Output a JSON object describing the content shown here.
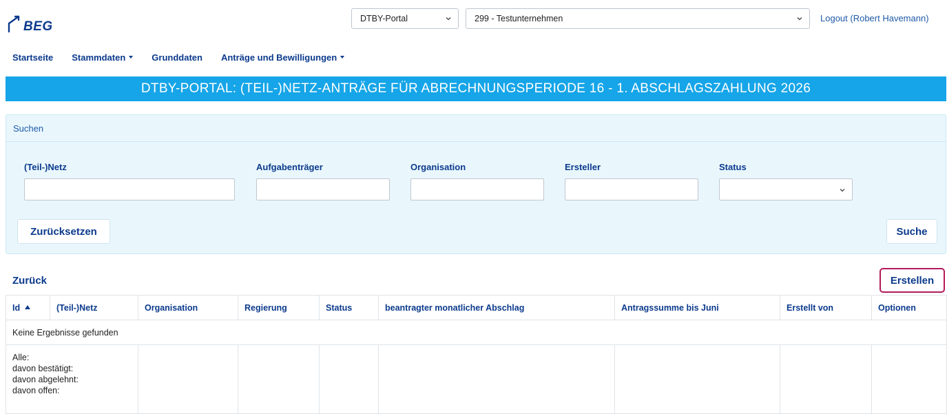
{
  "header": {
    "logo_text": "BEG",
    "portal_select": "DTBY-Portal",
    "company_select": "299 - Testunternehmen",
    "logout": "Logout (Robert Havemann)"
  },
  "nav": {
    "items": [
      {
        "label": "Startseite",
        "dropdown": false
      },
      {
        "label": "Stammdaten",
        "dropdown": true
      },
      {
        "label": "Grunddaten",
        "dropdown": false
      },
      {
        "label": "Anträge und Bewilligungen",
        "dropdown": true
      }
    ]
  },
  "banner": {
    "title": "DTBY-PORTAL: (TEIL-)NETZ-ANTRÄGE FÜR ABRECHNUNGSPERIODE 16 - 1. ABSCHLAGSZAHLUNG 2026"
  },
  "search": {
    "heading": "Suchen",
    "fields": {
      "netz": {
        "label": "(Teil-)Netz",
        "value": ""
      },
      "aufgabentraeger": {
        "label": "Aufgabenträger",
        "value": ""
      },
      "organisation": {
        "label": "Organisation",
        "value": ""
      },
      "ersteller": {
        "label": "Ersteller",
        "value": ""
      },
      "status": {
        "label": "Status",
        "value": ""
      }
    },
    "reset_label": "Zurücksetzen",
    "search_label": "Suche"
  },
  "actions": {
    "back_label": "Zurück",
    "create_label": "Erstellen"
  },
  "table": {
    "columns": [
      "Id",
      "(Teil-)Netz",
      "Organisation",
      "Regierung",
      "Status",
      "beantragter monatlicher Abschlag",
      "Antragssumme bis Juni",
      "Erstellt von",
      "Optionen"
    ],
    "sort_column": "Id",
    "sort_direction": "ascending",
    "empty_message": "Keine Ergebnisse gefunden",
    "summary_lines": [
      "Alle:",
      "davon bestätigt:",
      "davon abgelehnt:",
      "davon offen:"
    ]
  },
  "colors": {
    "brand_dark": "#0b3a8c",
    "banner": "#16a5e8",
    "panel_bg": "#e9f7fd",
    "create_border": "#b3195a"
  }
}
